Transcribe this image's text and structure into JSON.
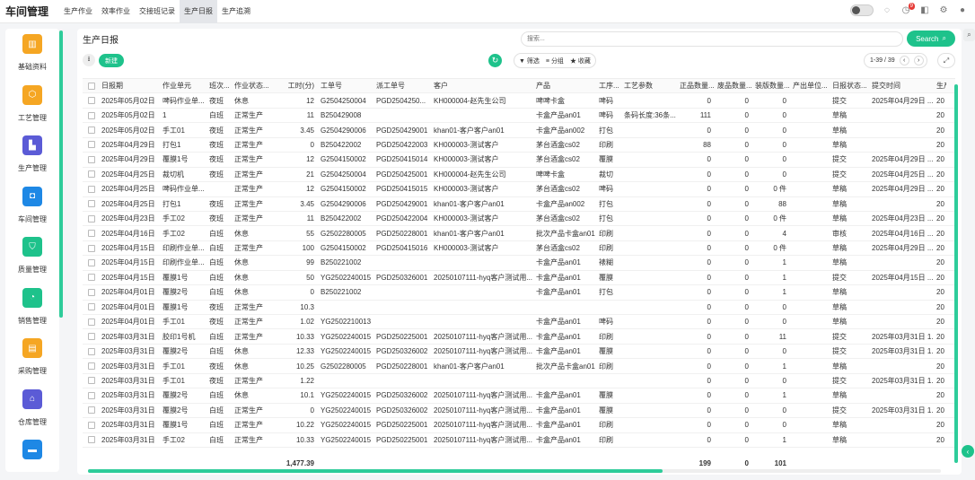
{
  "app_title": "车间管理",
  "top_nav": [
    {
      "label": "生产作业",
      "active": false
    },
    {
      "label": "效率作业",
      "active": false
    },
    {
      "label": "交接班记录",
      "active": false
    },
    {
      "label": "生产日报",
      "active": true
    },
    {
      "label": "生产追溯",
      "active": false
    }
  ],
  "notification_count": "9",
  "sidebar": [
    {
      "label": "基础资料",
      "icon": "grid-icon",
      "color": "#f5a623"
    },
    {
      "label": "工艺管理",
      "icon": "process-icon",
      "color": "#f5a623"
    },
    {
      "label": "生产管理",
      "icon": "factory-icon",
      "color": "#5b5bd6"
    },
    {
      "label": "车间管理",
      "icon": "workshop-icon",
      "color": "#1e88e5"
    },
    {
      "label": "质量管理",
      "icon": "shield-icon",
      "color": "#1ec28b"
    },
    {
      "label": "销售管理",
      "icon": "pie-icon",
      "color": "#1ec28b"
    },
    {
      "label": "采购管理",
      "icon": "purchase-icon",
      "color": "#f5a623"
    },
    {
      "label": "仓库管理",
      "icon": "warehouse-icon",
      "color": "#5b5bd6"
    },
    {
      "label": "",
      "icon": "more-icon",
      "color": "#1e88e5"
    }
  ],
  "page_title": "生产日报",
  "search": {
    "placeholder": "搜索...",
    "button_label": "Search"
  },
  "toolbar": {
    "new_label": "新建",
    "filter_label": "筛选",
    "group_label": "分组",
    "favorite_label": "收藏"
  },
  "pager": {
    "text": "1-39 / 39"
  },
  "columns": [
    "日报期",
    "作业单元",
    "班次...",
    "作业状态...",
    "工时(分)",
    "工单号",
    "派工单号",
    "客户",
    "产品",
    "工序...",
    "工艺参数",
    "正品数量...",
    "废品数量...",
    "装版数量...",
    "产出单位...",
    "日报状态...",
    "提交时间",
    "生产"
  ],
  "rows": [
    [
      "2025年05月02日",
      "啤码作业单...",
      "夜班",
      "休息",
      "12",
      "G2504250004",
      "PGD2504250...",
      "KH000004-赵先生公司",
      "啤啤卡盒",
      "啤码",
      "",
      "0",
      "0",
      "0",
      "",
      "提交",
      "2025年04月29日 ...",
      "20"
    ],
    [
      "2025年05月02日",
      "1",
      "白班",
      "正常生产",
      "11",
      "B250429008",
      "",
      "",
      "卡盒产品an01",
      "啤码",
      "条码长度:36条...",
      "111",
      "0",
      "0",
      "",
      "草稿",
      "",
      "20"
    ],
    [
      "2025年05月02日",
      "手工01",
      "夜班",
      "正常生产",
      "3.45",
      "G2504290006",
      "PGD250429001",
      "khan01-客户客户an01",
      "卡盒产品an002",
      "打包",
      "",
      "0",
      "0",
      "0",
      "",
      "草稿",
      "",
      "20"
    ],
    [
      "2025年04月29日",
      "打包1",
      "夜班",
      "正常生产",
      "0",
      "B250422002",
      "PGD250422003",
      "KH000003-测试客户",
      "茅台酒盒cs02",
      "印刷",
      "",
      "88",
      "0",
      "0",
      "",
      "草稿",
      "",
      "20"
    ],
    [
      "2025年04月29日",
      "覆膜1号",
      "夜班",
      "正常生产",
      "12",
      "G2504150002",
      "PGD250415014",
      "KH000003-测试客户",
      "茅台酒盒cs02",
      "覆膜",
      "",
      "0",
      "0",
      "0",
      "",
      "提交",
      "2025年04月29日 ...",
      "20"
    ],
    [
      "2025年04月25日",
      "裁切机",
      "夜班",
      "正常生产",
      "21",
      "G2504250004",
      "PGD250425001",
      "KH000004-赵先生公司",
      "啤啤卡盒",
      "裁切",
      "",
      "0",
      "0",
      "0",
      "",
      "提交",
      "2025年04月25日 ...",
      "20"
    ],
    [
      "2025年04月25日",
      "啤码作业单...",
      "",
      "正常生产",
      "12",
      "G2504150002",
      "PGD250415015",
      "KH000003-测试客户",
      "茅台酒盒cs02",
      "啤码",
      "",
      "0",
      "0",
      "0 件",
      "",
      "草稿",
      "2025年04月29日 ...",
      "20"
    ],
    [
      "2025年04月25日",
      "打包1",
      "夜班",
      "正常生产",
      "3.45",
      "G2504290006",
      "PGD250429001",
      "khan01-客户客户an01",
      "卡盒产品an002",
      "打包",
      "",
      "0",
      "0",
      "88",
      "",
      "草稿",
      "",
      "20"
    ],
    [
      "2025年04月23日",
      "手工02",
      "夜班",
      "正常生产",
      "11",
      "B250422002",
      "PGD250422004",
      "KH000003-测试客户",
      "茅台酒盒cs02",
      "打包",
      "",
      "0",
      "0",
      "0 件",
      "",
      "草稿",
      "2025年04月23日 ...",
      "20"
    ],
    [
      "2025年04月16日",
      "手工02",
      "白班",
      "休息",
      "55",
      "G2502280005",
      "PGD250228001",
      "khan01-客户客户an01",
      "批次产品卡盒an01",
      "印刷",
      "",
      "0",
      "0",
      "4",
      "",
      "审核",
      "2025年04月16日 ...",
      "20"
    ],
    [
      "2025年04月15日",
      "印刷作业单...",
      "白班",
      "正常生产",
      "100",
      "G2504150002",
      "PGD250415016",
      "KH000003-测试客户",
      "茅台酒盒cs02",
      "印刷",
      "",
      "0",
      "0",
      "0 件",
      "",
      "草稿",
      "2025年04月29日 ...",
      "20"
    ],
    [
      "2025年04月15日",
      "印刷作业单...",
      "白班",
      "休息",
      "99",
      "B250221002",
      "",
      "",
      "卡盒产品an01",
      "裱糊",
      "",
      "0",
      "0",
      "1",
      "",
      "草稿",
      "",
      "20"
    ],
    [
      "2025年04月15日",
      "覆膜1号",
      "白班",
      "休息",
      "50",
      "YG2502240015",
      "PGD250326001",
      "20250107111-hyq客户测试用...",
      "卡盒产品an01",
      "覆膜",
      "",
      "0",
      "0",
      "1",
      "",
      "提交",
      "2025年04月15日 ...",
      "20"
    ],
    [
      "2025年04月01日",
      "覆膜2号",
      "白班",
      "休息",
      "0",
      "B250221002",
      "",
      "",
      "卡盒产品an01",
      "打包",
      "",
      "0",
      "0",
      "1",
      "",
      "草稿",
      "",
      "20"
    ],
    [
      "2025年04月01日",
      "覆膜1号",
      "夜班",
      "正常生产",
      "10.3",
      "",
      "",
      "",
      "",
      "",
      "",
      "0",
      "0",
      "0",
      "",
      "草稿",
      "",
      "20"
    ],
    [
      "2025年04月01日",
      "手工01",
      "夜班",
      "正常生产",
      "1.02",
      "YG2502210013",
      "",
      "",
      "卡盒产品an01",
      "啤码",
      "",
      "0",
      "0",
      "0",
      "",
      "草稿",
      "",
      "20"
    ],
    [
      "2025年03月31日",
      "胶印1号机",
      "白班",
      "正常生产",
      "10.33",
      "YG2502240015",
      "PGD250225001",
      "20250107111-hyq客户测试用...",
      "卡盒产品an01",
      "印刷",
      "",
      "0",
      "0",
      "11",
      "",
      "提交",
      "2025年03月31日 1...",
      "20"
    ],
    [
      "2025年03月31日",
      "覆膜2号",
      "白班",
      "休息",
      "12.33",
      "YG2502240015",
      "PGD250326002",
      "20250107111-hyq客户测试用...",
      "卡盒产品an01",
      "覆膜",
      "",
      "0",
      "0",
      "0",
      "",
      "提交",
      "2025年03月31日 1...",
      "20"
    ],
    [
      "2025年03月31日",
      "手工01",
      "夜班",
      "休息",
      "10.25",
      "G2502280005",
      "PGD250228001",
      "khan01-客户客户an01",
      "批次产品卡盒an01",
      "印刷",
      "",
      "0",
      "0",
      "1",
      "",
      "草稿",
      "",
      "20"
    ],
    [
      "2025年03月31日",
      "手工01",
      "夜班",
      "正常生产",
      "1.22",
      "",
      "",
      "",
      "",
      "",
      "",
      "0",
      "0",
      "0",
      "",
      "提交",
      "2025年03月31日 1...",
      "20"
    ],
    [
      "2025年03月31日",
      "覆膜2号",
      "白班",
      "休息",
      "10.1",
      "YG2502240015",
      "PGD250326002",
      "20250107111-hyq客户测试用...",
      "卡盒产品an01",
      "覆膜",
      "",
      "0",
      "0",
      "1",
      "",
      "草稿",
      "",
      "20"
    ],
    [
      "2025年03月31日",
      "覆膜2号",
      "白班",
      "正常生产",
      "0",
      "YG2502240015",
      "PGD250326002",
      "20250107111-hyq客户测试用...",
      "卡盒产品an01",
      "覆膜",
      "",
      "0",
      "0",
      "0",
      "",
      "提交",
      "2025年03月31日 1...",
      "20"
    ],
    [
      "2025年03月31日",
      "覆膜1号",
      "白班",
      "正常生产",
      "10.22",
      "YG2502240015",
      "PGD250225001",
      "20250107111-hyq客户测试用...",
      "卡盒产品an01",
      "印刷",
      "",
      "0",
      "0",
      "0",
      "",
      "草稿",
      "",
      "20"
    ],
    [
      "2025年03月31日",
      "手工02",
      "白班",
      "正常生产",
      "10.33",
      "YG2502240015",
      "PGD250225001",
      "20250107111-hyq客户测试用...",
      "卡盒产品an01",
      "印刷",
      "",
      "0",
      "0",
      "1",
      "",
      "草稿",
      "",
      "20"
    ]
  ],
  "totals": {
    "work_hours": "1,477.39",
    "good_qty": "199",
    "scrap_qty": "0",
    "plate_qty": "101"
  }
}
